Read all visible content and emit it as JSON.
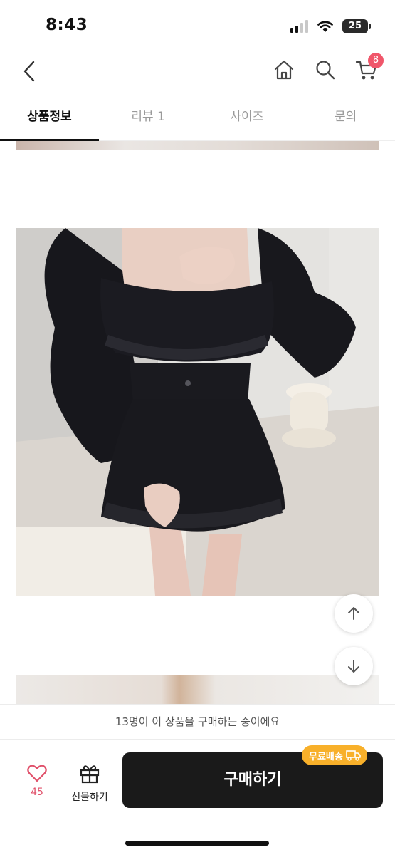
{
  "status_bar": {
    "time": "8:43",
    "battery": "25"
  },
  "nav": {
    "back_icon": "chevron-left-icon",
    "home_icon": "home-icon",
    "search_icon": "search-icon",
    "cart_icon": "cart-icon",
    "cart_count": "8"
  },
  "tabs": [
    {
      "label": "상품정보",
      "active": true
    },
    {
      "label": "리뷰 1",
      "active": false
    },
    {
      "label": "사이즈",
      "active": false
    },
    {
      "label": "문의",
      "active": false
    }
  ],
  "notice": {
    "text": "13명이 이 상품을 구매하는 중이에요"
  },
  "actions": {
    "like_count": "45",
    "gift_label": "선물하기",
    "buy_label": "구매하기",
    "shipping_badge": "무료배송"
  },
  "colors": {
    "accent": "#f0566a",
    "buy_button": "#1a1a1a",
    "shipping_badge": "#f8b02a"
  }
}
